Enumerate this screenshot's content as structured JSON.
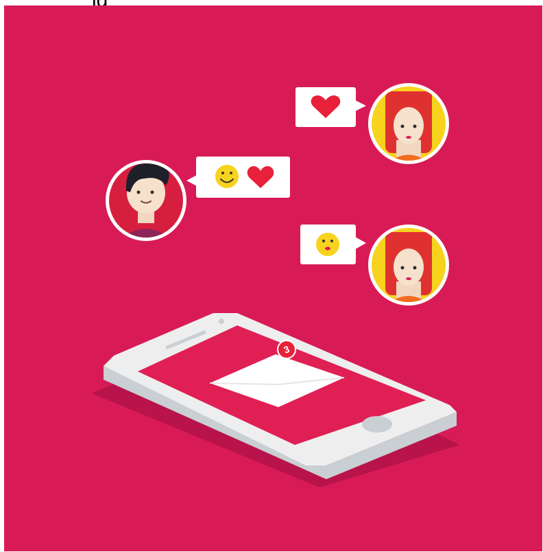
{
  "header": {
    "cropped_text": "jg"
  },
  "colors": {
    "background": "#d81b57",
    "white": "#ffffff",
    "heart": "#e8203a",
    "emoji": "#f7d31e",
    "girl_hair": "#e03131",
    "girl_bg": "#f7d31e",
    "boy_bg": "#d61f3e",
    "phone_body": "#eeeeee",
    "phone_screen": "#e01f55"
  },
  "illustration": {
    "messages": [
      {
        "from": "girl-top",
        "content_icons": [
          "heart-icon"
        ]
      },
      {
        "from": "boy",
        "content_icons": [
          "smiley-icon",
          "heart-icon"
        ]
      },
      {
        "from": "girl-bottom",
        "content_icons": [
          "smiley-icon"
        ]
      }
    ],
    "phone": {
      "notification_count": "3"
    }
  }
}
